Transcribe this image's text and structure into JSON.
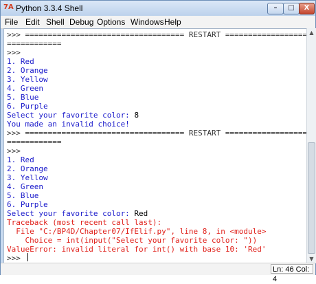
{
  "window": {
    "title": "Python 3.3.4 Shell",
    "icon": "7A",
    "minimize": "–",
    "maximize": "□",
    "close": "X"
  },
  "menubar": {
    "items": [
      "File",
      "Edit",
      "Shell",
      "Debug",
      "Options",
      "Windows",
      "Help"
    ]
  },
  "shell": {
    "lines": [
      {
        "text": ">>> =================================== RESTART ======================",
        "kind": "prompt"
      },
      {
        "text": "============",
        "kind": "prompt"
      },
      {
        "text": ">>>",
        "kind": "prompt"
      },
      {
        "text": "1. Red",
        "kind": "out"
      },
      {
        "text": "2. Orange",
        "kind": "out"
      },
      {
        "text": "3. Yellow",
        "kind": "out"
      },
      {
        "text": "4. Green",
        "kind": "out"
      },
      {
        "text": "5. Blue",
        "kind": "out"
      },
      {
        "text": "6. Purple",
        "kind": "out"
      },
      {
        "text": "Select your favorite color: ",
        "input": "8",
        "kind": "out"
      },
      {
        "text": "You made an invalid choice!",
        "kind": "out"
      },
      {
        "text": ">>> =================================== RESTART ======================",
        "kind": "prompt"
      },
      {
        "text": "============",
        "kind": "prompt"
      },
      {
        "text": ">>>",
        "kind": "prompt"
      },
      {
        "text": "1. Red",
        "kind": "out"
      },
      {
        "text": "2. Orange",
        "kind": "out"
      },
      {
        "text": "3. Yellow",
        "kind": "out"
      },
      {
        "text": "4. Green",
        "kind": "out"
      },
      {
        "text": "5. Blue",
        "kind": "out"
      },
      {
        "text": "6. Purple",
        "kind": "out"
      },
      {
        "text": "Select your favorite color: ",
        "input": "Red",
        "kind": "out"
      },
      {
        "text": "Traceback (most recent call last):",
        "kind": "err"
      },
      {
        "text": "  File \"C:/BP4D/Chapter07/IfElif.py\", line 8, in <module>",
        "kind": "err"
      },
      {
        "text": "    Choice = int(input(\"Select your favorite color: \"))",
        "kind": "err"
      },
      {
        "text": "ValueError: invalid literal for int() with base 10: 'Red'",
        "kind": "err"
      },
      {
        "text": ">>> ",
        "kind": "prompt"
      }
    ]
  },
  "statusbar": {
    "position": "Ln: 46 Col: 4"
  },
  "colors": {
    "output": "#1a1acb",
    "error": "#e0201a",
    "prompt": "#333333"
  }
}
